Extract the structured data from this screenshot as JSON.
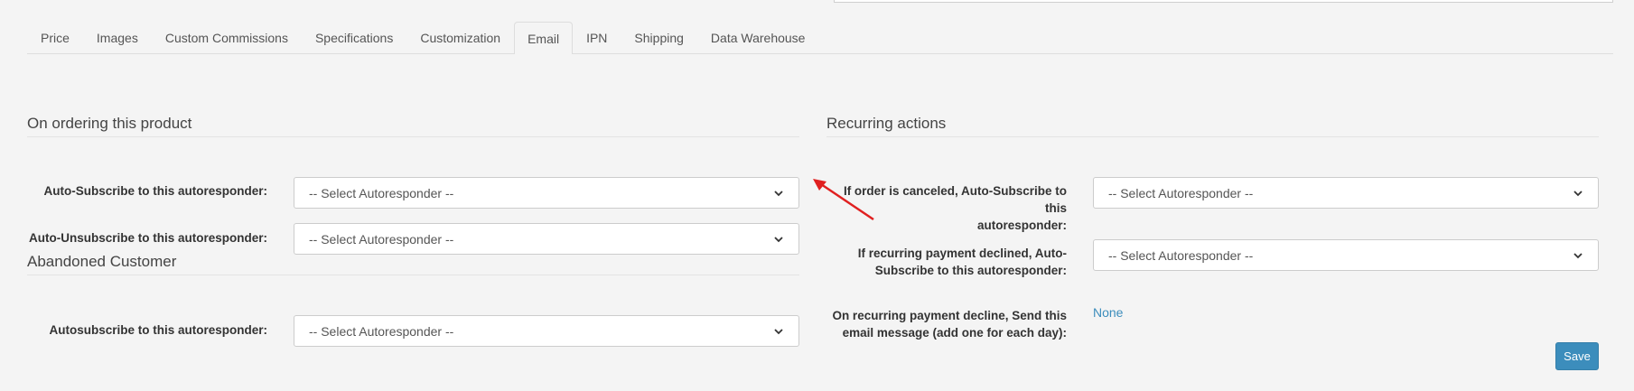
{
  "tabs": [
    {
      "label": "Price",
      "active": false
    },
    {
      "label": "Images",
      "active": false
    },
    {
      "label": "Custom Commissions",
      "active": false
    },
    {
      "label": "Specifications",
      "active": false
    },
    {
      "label": "Customization",
      "active": false
    },
    {
      "label": "Email",
      "active": true
    },
    {
      "label": "IPN",
      "active": false
    },
    {
      "label": "Shipping",
      "active": false
    },
    {
      "label": "Data Warehouse",
      "active": false
    }
  ],
  "ordering": {
    "title": "On ordering this product",
    "subscribe_label": "Auto-Subscribe to this autoresponder:",
    "subscribe_value": "-- Select Autoresponder --",
    "unsubscribe_label": "Auto-Unsubscribe to this autoresponder:",
    "unsubscribe_value": "-- Select Autoresponder --"
  },
  "abandoned": {
    "title": "Abandoned Customer",
    "subscribe_label": "Autosubscribe to this autoresponder:",
    "subscribe_value": "-- Select Autoresponder --"
  },
  "recurring": {
    "title": "Recurring actions",
    "canceled_label_line1": "If order is canceled, Auto-Subscribe to this",
    "canceled_label_line2": "autoresponder:",
    "canceled_value": "-- Select Autoresponder --",
    "declined_label_line1": "If recurring payment declined, Auto-",
    "declined_label_line2": "Subscribe to this autoresponder:",
    "declined_value": "-- Select Autoresponder --",
    "email_label_line1": "On recurring payment decline, Send this",
    "email_label_line2": "email message (add one for each day):",
    "email_value": "None"
  },
  "save_label": "Save",
  "colors": {
    "accent": "#3c8dbc",
    "annotation_arrow": "#e02020"
  }
}
